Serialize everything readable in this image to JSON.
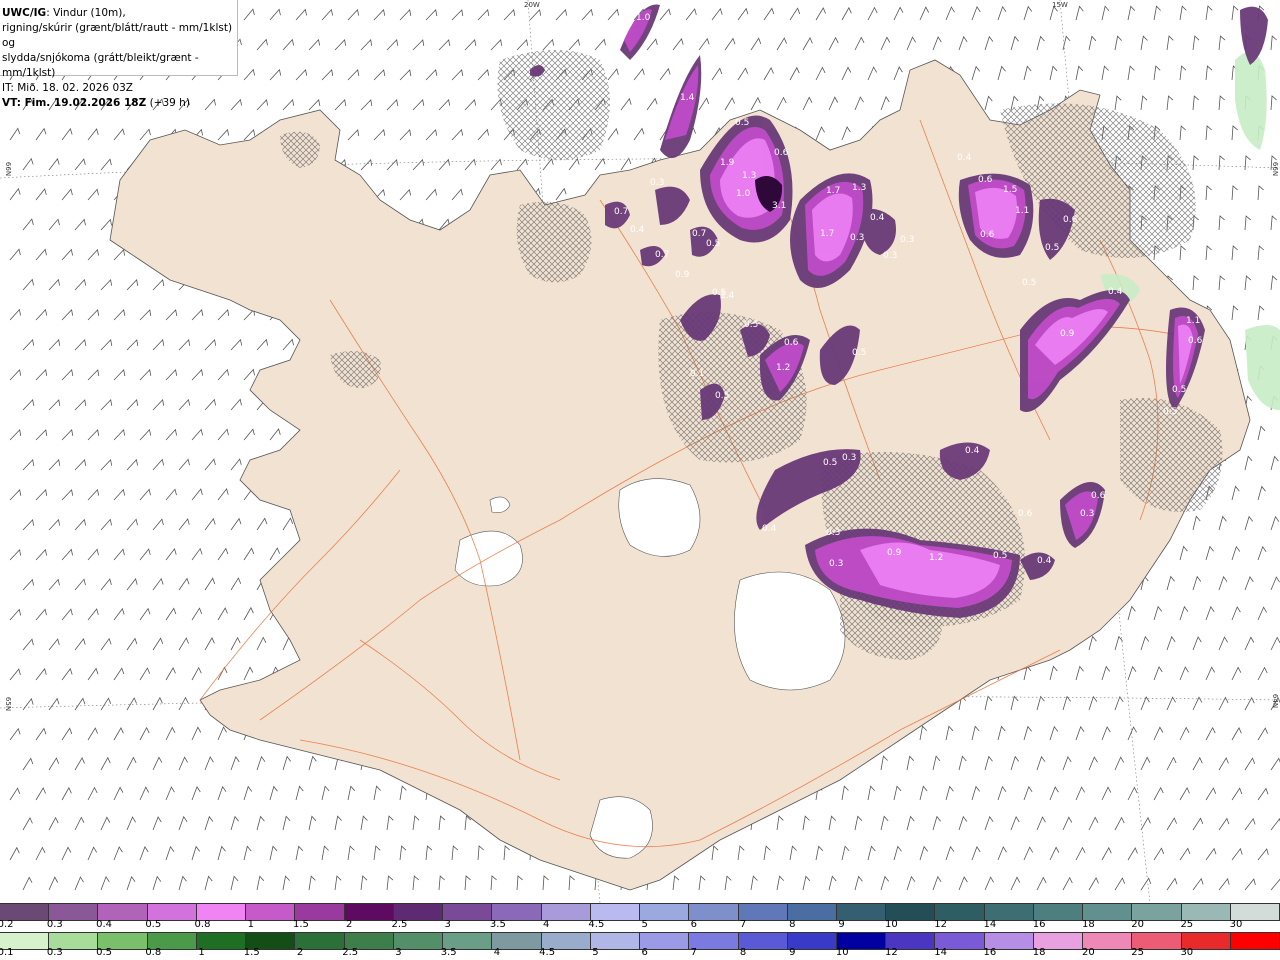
{
  "header": {
    "model": "UWC/IG",
    "line1_rest": ": Vindur (10m),",
    "line2": "rigning/skúrir (grænt/blátt/rautt - mm/1klst) og",
    "line3": "slydda/snjókoma (grátt/bleikt/grænt - mm/1klst)",
    "line4": "IT: Mið. 18. 02. 2026 03Z",
    "line5_label": "VT: Fim. 19.02.2026 18Z",
    "line5_rest": " (+39 h)"
  },
  "axis_labels": {
    "top_left": "20W",
    "top_right": "15W",
    "left_upper": "66N",
    "left_lower": "65N",
    "right_upper": "66N",
    "right_lower": "64N"
  },
  "colors": {
    "land": "#f2e2d1",
    "sea": "#ffffff",
    "roads": "#e8703a",
    "precip_dark": "#6a3a78",
    "precip_mid": "#c04cc8",
    "precip_light": "#ea7ef2",
    "rain_green": "#c8ecc4"
  },
  "snow_scale": {
    "labels": [
      "0.2",
      "0.3",
      "0.4",
      "0.5",
      "0.8",
      "1",
      "1.5",
      "2",
      "2.5",
      "3",
      "3.5",
      "4",
      "4.5",
      "5",
      "6",
      "7",
      "8",
      "9",
      "10",
      "12",
      "14",
      "16",
      "18",
      "20",
      "25",
      "30"
    ],
    "colors": [
      "#6b4876",
      "#8a5797",
      "#b063b9",
      "#d272dc",
      "#f084f4",
      "#c65acb",
      "#9a3a9f",
      "#5e0a60",
      "#5d2a73",
      "#7a4a99",
      "#8b69b9",
      "#a99ad9",
      "#b9baf0",
      "#9ca8e0",
      "#7e90cc",
      "#6078b8",
      "#4a6ea3",
      "#345f72",
      "#234e57",
      "#2e5d63",
      "#3f6e72",
      "#4d7e80",
      "#61908f",
      "#7aa3a0",
      "#9ab9b6",
      "#d2dcd9"
    ]
  },
  "rain_scale": {
    "labels": [
      "0.1",
      "0.3",
      "0.5",
      "0.8",
      "1",
      "1.5",
      "2",
      "2.5",
      "3",
      "3.5",
      "4",
      "4.5",
      "5",
      "6",
      "7",
      "8",
      "9",
      "10",
      "12",
      "14",
      "16",
      "18",
      "20",
      "25",
      "30"
    ],
    "colors": [
      "#d6f2cc",
      "#a8dc9a",
      "#7ac06a",
      "#4a9a4a",
      "#1e6e24",
      "#134e16",
      "#2a7038",
      "#3e7e4a",
      "#53906a",
      "#6a9e86",
      "#7e9aa0",
      "#9aaccc",
      "#b0b6e6",
      "#9a9ae6",
      "#7a7ae0",
      "#5a5ad6",
      "#3a3ac8",
      "#0000a0",
      "#4a36c0",
      "#7a5ad6",
      "#b68ee6",
      "#e8a0e0",
      "#ee88b6",
      "#ec5c74",
      "#e82a2a",
      "#ff0000"
    ]
  },
  "precip_labels": [
    {
      "v": "1.0"
    },
    {
      "v": "0.3"
    },
    {
      "v": "0.5"
    },
    {
      "v": "1.4"
    },
    {
      "v": "0.5"
    },
    {
      "v": "1.9"
    },
    {
      "v": "0.6"
    },
    {
      "v": "1.3"
    },
    {
      "v": "1.0"
    },
    {
      "v": "3.1"
    },
    {
      "v": "1.7"
    },
    {
      "v": "1.3"
    },
    {
      "v": "0.3"
    },
    {
      "v": "0.7"
    },
    {
      "v": "0.4"
    },
    {
      "v": "0.7"
    },
    {
      "v": "0.5"
    },
    {
      "v": "0.7"
    },
    {
      "v": "0.9"
    },
    {
      "v": "1.7"
    },
    {
      "v": "0.4"
    },
    {
      "v": "0.3"
    },
    {
      "v": "0.3"
    },
    {
      "v": "0.3"
    },
    {
      "v": "1.1"
    },
    {
      "v": "1.5"
    },
    {
      "v": "0.6"
    },
    {
      "v": "0.5"
    },
    {
      "v": "0.6"
    },
    {
      "v": "0.4"
    },
    {
      "v": "0.6"
    },
    {
      "v": "0.5"
    },
    {
      "v": "0.4"
    },
    {
      "v": "0.9"
    },
    {
      "v": "1.1"
    },
    {
      "v": "0.6"
    },
    {
      "v": "0.5"
    },
    {
      "v": "0.5"
    },
    {
      "v": "0.5"
    },
    {
      "v": "1.4"
    },
    {
      "v": "0.5"
    },
    {
      "v": "0.6"
    },
    {
      "v": "1.2"
    },
    {
      "v": "0.5"
    },
    {
      "v": "0.1"
    },
    {
      "v": "0.5"
    },
    {
      "v": "0.3"
    },
    {
      "v": "0.5"
    },
    {
      "v": "0.4"
    },
    {
      "v": "0.4"
    },
    {
      "v": "0.3"
    },
    {
      "v": "0.3"
    },
    {
      "v": "0.9"
    },
    {
      "v": "1.2"
    },
    {
      "v": "0.5"
    },
    {
      "v": "0.4"
    },
    {
      "v": "0.6"
    },
    {
      "v": "0.6"
    },
    {
      "v": "0.3"
    }
  ]
}
